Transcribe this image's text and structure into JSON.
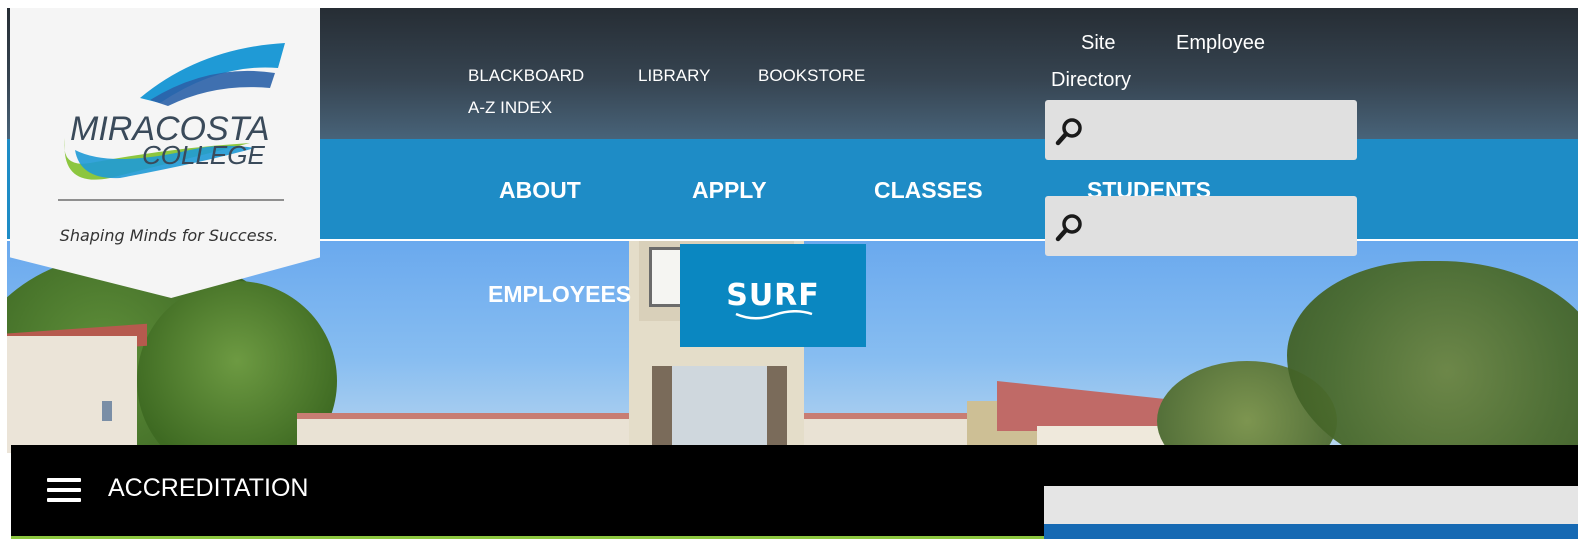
{
  "logo": {
    "name": "MiraCosta College",
    "wordmark_line1": "MIRACOSTA",
    "wordmark_line2": "COLLEGE",
    "tagline": "Shaping Minds for Success."
  },
  "utility_nav": {
    "items": [
      {
        "label": "BLACKBOARD"
      },
      {
        "label": "LIBRARY"
      },
      {
        "label": "BOOKSTORE"
      },
      {
        "label": "A-Z INDEX"
      }
    ]
  },
  "site_links": {
    "site": "Site",
    "employee": "Employee",
    "directory": "Directory"
  },
  "search": {
    "icon": "search-icon",
    "primary_placeholder": "",
    "secondary_placeholder": ""
  },
  "main_nav": {
    "items": [
      {
        "label": "ABOUT"
      },
      {
        "label": "APPLY"
      },
      {
        "label": "CLASSES"
      },
      {
        "label": "STUDENTS"
      },
      {
        "label": "EMPLOYEES"
      }
    ],
    "surf_label": "SURF"
  },
  "section_bar": {
    "menu_icon": "hamburger-menu-icon",
    "title": "ACCREDITATION"
  },
  "colors": {
    "topbar": "#262d34",
    "nav_blue": "#1e8cc6",
    "surf_blue": "#0a87c1",
    "section_bar": "#000000",
    "accent_green": "#8cc63f",
    "panel_blue": "#1669b3"
  }
}
